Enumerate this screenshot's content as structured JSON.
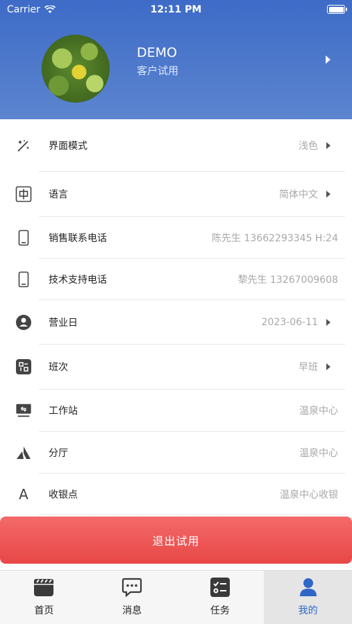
{
  "status_bar": {
    "carrier": "Carrier",
    "time": "12:11 PM",
    "battery_level": 1.0
  },
  "profile": {
    "name": "DEMO",
    "subtitle": "客户试用"
  },
  "settings": [
    {
      "label": "界面模式",
      "value": "浅色",
      "chevron": true,
      "icon": "theme-mode-icon"
    },
    {
      "label": "语言",
      "value": "简体中文",
      "chevron": true,
      "icon": "language-icon"
    },
    {
      "label": "销售联系电话",
      "value": "陈先生 13662293345 H:24",
      "chevron": false,
      "icon": "phone-icon"
    },
    {
      "label": "技术支持电话",
      "value": "黎先生 13267009608",
      "chevron": false,
      "icon": "phone-icon"
    },
    {
      "label": "营业日",
      "value": "2023-06-11",
      "chevron": true,
      "icon": "business-day-icon"
    },
    {
      "label": "班次",
      "value": "早班",
      "chevron": true,
      "icon": "shift-icon"
    },
    {
      "label": "工作站",
      "value": "温泉中心",
      "chevron": false,
      "icon": "workstation-icon"
    },
    {
      "label": "分厅",
      "value": "温泉中心",
      "chevron": false,
      "icon": "hall-icon"
    },
    {
      "label": "收银点",
      "value": "温泉中心收银",
      "chevron": false,
      "icon": "cashier-icon"
    }
  ],
  "logout_label": "退出试用",
  "tabs": [
    {
      "label": "首页",
      "icon": "home-icon",
      "active": false
    },
    {
      "label": "消息",
      "icon": "message-icon",
      "active": false
    },
    {
      "label": "任务",
      "icon": "task-icon",
      "active": false
    },
    {
      "label": "我的",
      "icon": "profile-icon",
      "active": true
    }
  ],
  "colors": {
    "header": "#4a74c9",
    "accent": "#2e67c6",
    "logout": "#ec5252"
  }
}
